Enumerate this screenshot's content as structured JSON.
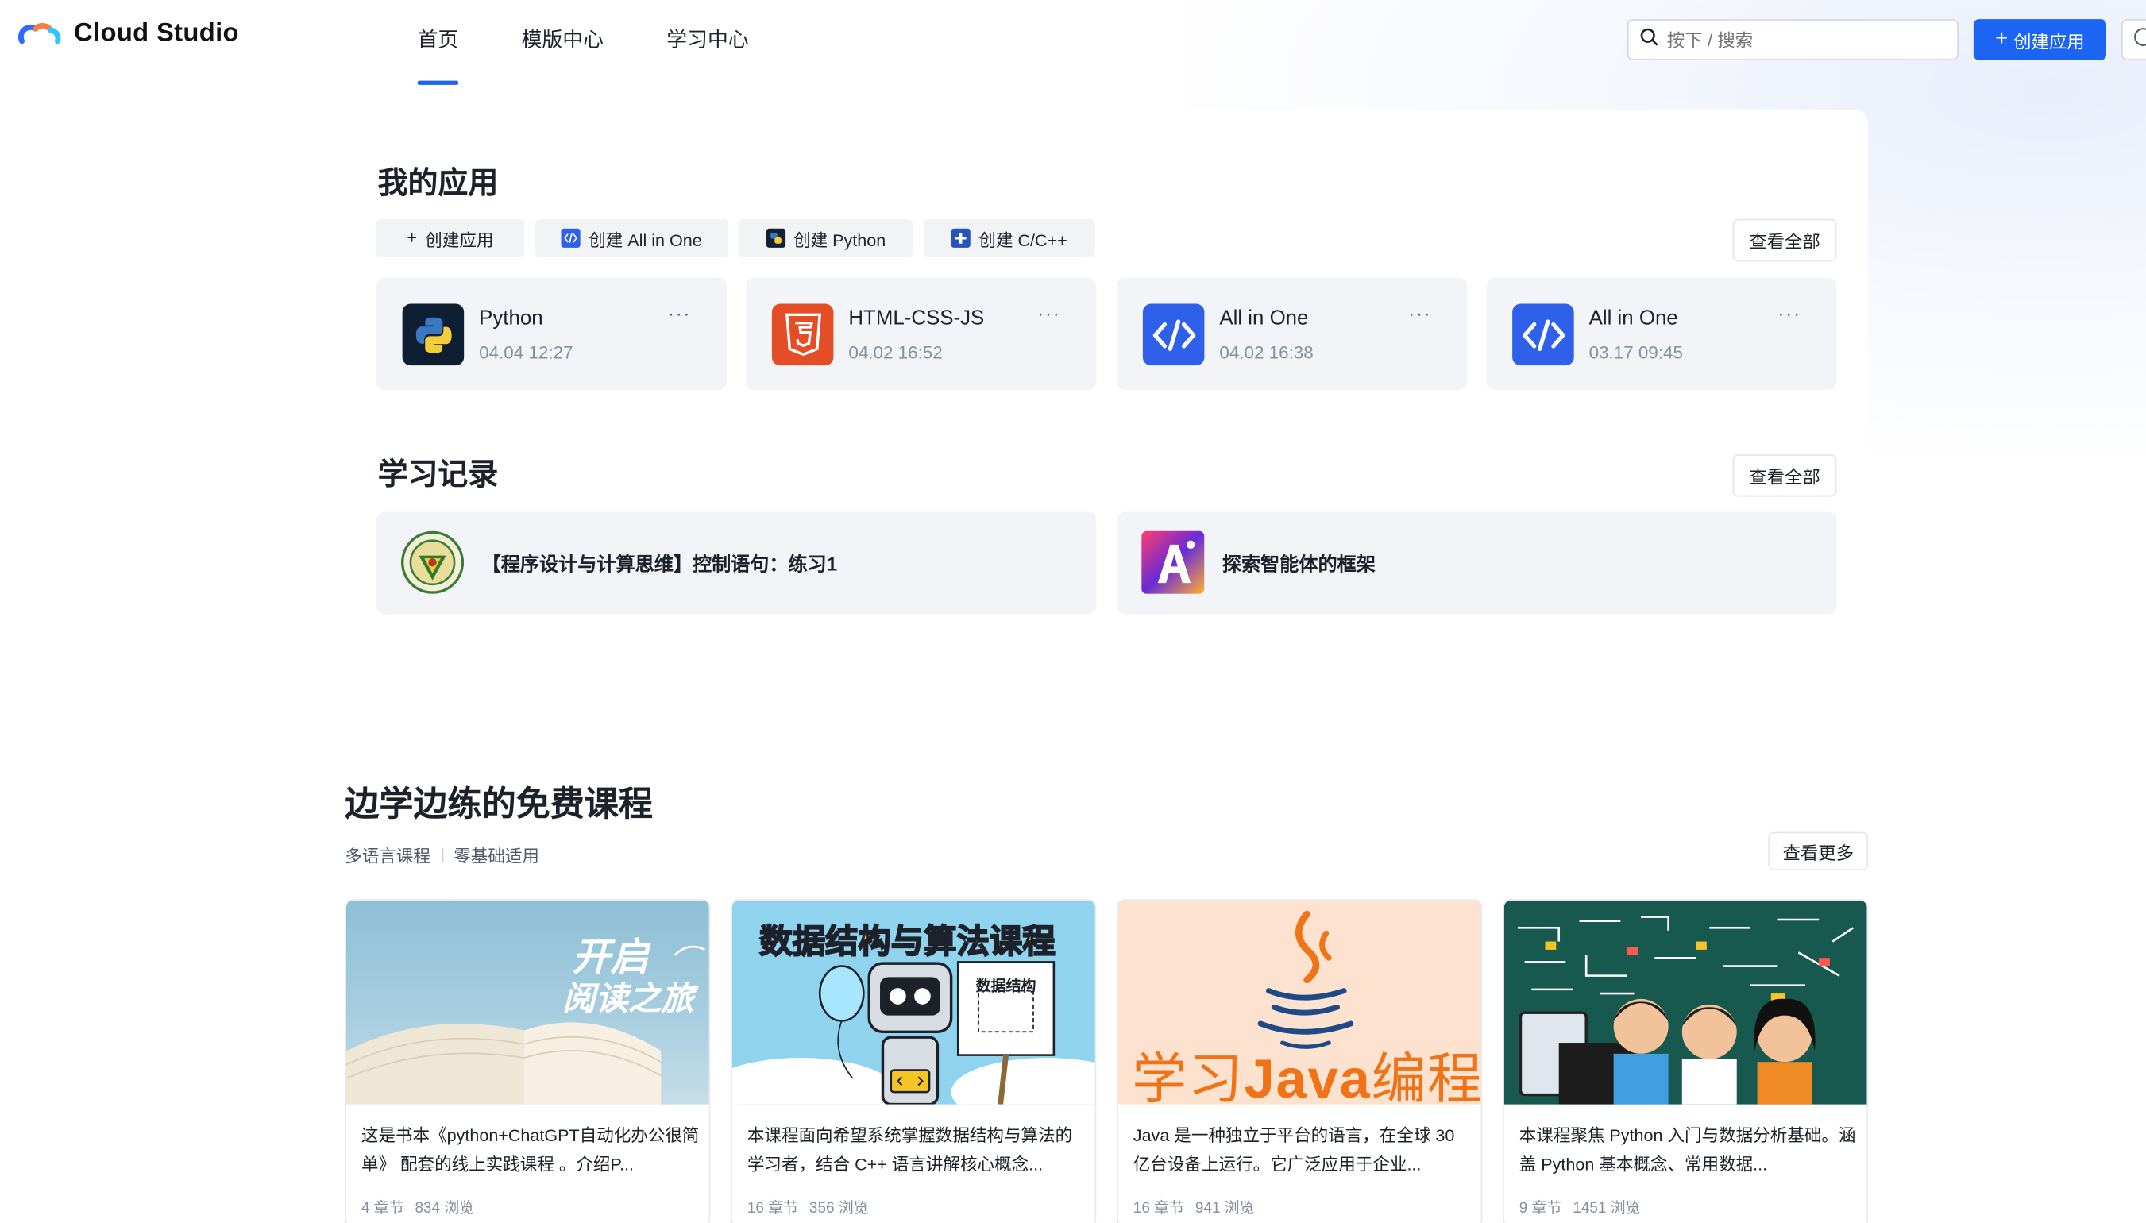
{
  "header": {
    "brand": "Cloud Studio",
    "nav": [
      {
        "label": "首页",
        "active": true
      },
      {
        "label": "模版中心",
        "active": false
      },
      {
        "label": "学习中心",
        "active": false
      }
    ],
    "search_placeholder": "按下 / 搜索",
    "create_label": "创建应用",
    "accent": "#1c64f2"
  },
  "my_apps": {
    "title": "我的应用",
    "view_all": "查看全部",
    "quick_create": [
      {
        "label": "创建应用",
        "icon": "plus-icon"
      },
      {
        "label": "创建 All in One",
        "icon": "code-icon"
      },
      {
        "label": "创建 Python",
        "icon": "python-icon"
      },
      {
        "label": "创建 C/C++",
        "icon": "cpp-icon"
      }
    ],
    "apps": [
      {
        "name": "Python",
        "time": "04.04 12:27",
        "icon": "python-icon",
        "more": "···"
      },
      {
        "name": "HTML-CSS-JS",
        "time": "04.02 16:52",
        "icon": "html5-icon",
        "more": "···"
      },
      {
        "name": "All in One",
        "time": "04.02 16:38",
        "icon": "code-icon",
        "more": "···"
      },
      {
        "name": "All in One",
        "time": "03.17 09:45",
        "icon": "code-icon",
        "more": "···"
      }
    ]
  },
  "learning": {
    "title": "学习记录",
    "view_all": "查看全部",
    "records": [
      {
        "title": "【程序设计与计算思维】控制语句：练习1",
        "icon": "university-seal-icon"
      },
      {
        "title": "探索智能体的框架",
        "icon": "ai-art-icon"
      }
    ]
  },
  "courses": {
    "title": "边学边练的免费课程",
    "tags": [
      "多语言课程",
      "零基础适用"
    ],
    "view_more": "查看更多",
    "items": [
      {
        "cover_text": [
          "开启",
          "阅读之旅"
        ],
        "desc": "这是书本《python+ChatGPT自动化办公很简单》 配套的线上实践课程 。介绍P...",
        "chapters": "4 章节",
        "views": "834 浏览"
      },
      {
        "cover_text": [
          "数据结构与算法课程",
          "数据结构"
        ],
        "desc": "本课程面向希望系统掌握数据结构与算法的学习者，结合 C++ 语言讲解核心概念...",
        "chapters": "16 章节",
        "views": "356 浏览"
      },
      {
        "cover_text": [
          "学习",
          "Java",
          "编程"
        ],
        "desc": "Java 是一种独立于平台的语言，在全球 30 亿台设备上运行。它广泛应用于企业...",
        "chapters": "16 章节",
        "views": "941 浏览"
      },
      {
        "cover_text": [],
        "desc": "本课程聚焦 Python 入门与数据分析基础。涵盖 Python 基本概念、常用数据...",
        "chapters": "9 章节",
        "views": "1451 浏览"
      }
    ]
  }
}
